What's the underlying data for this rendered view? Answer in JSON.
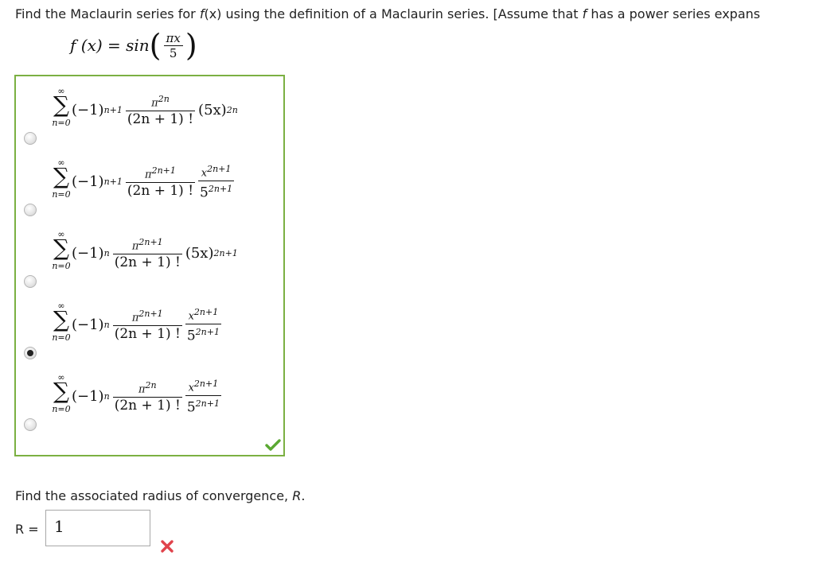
{
  "question1": {
    "text_a": "Find the Maclaurin series for ",
    "fx_italic": "f",
    "text_b": "(x) using the definition of a Maclaurin series. [Assume that ",
    "f_italic": "f",
    "text_c": " has a power series expans"
  },
  "function": {
    "lhs": "f (x) = sin",
    "numerator": "πx",
    "denominator": "5"
  },
  "options": [
    {
      "selected": false,
      "sum_top": "∞",
      "sum_bottom": "n=0",
      "sign": "(−1)",
      "sign_exp": "n+1",
      "num": "π",
      "num_exp": "2n",
      "den": "(2n + 1) !",
      "tail": "(5x)",
      "tail_exp": "2n"
    },
    {
      "selected": false,
      "sum_top": "∞",
      "sum_bottom": "n=0",
      "sign": "(−1)",
      "sign_exp": "n+1",
      "num": "π",
      "num_exp": "2n+1",
      "den": "(2n + 1) !",
      "num2": "x",
      "num2_exp": "2n+1",
      "den2": "5",
      "den2_exp": "2n+1"
    },
    {
      "selected": false,
      "sum_top": "∞",
      "sum_bottom": "n=0",
      "sign": "(−1)",
      "sign_exp": "n",
      "num": "π",
      "num_exp": "2n+1",
      "den": "(2n + 1) !",
      "tail": "(5x)",
      "tail_exp": "2n+1"
    },
    {
      "selected": true,
      "sum_top": "∞",
      "sum_bottom": "n=0",
      "sign": "(−1)",
      "sign_exp": "n",
      "num": "π",
      "num_exp": "2n+1",
      "den": "(2n + 1) !",
      "num2": "x",
      "num2_exp": "2n+1",
      "den2": "5",
      "den2_exp": "2n+1"
    },
    {
      "selected": false,
      "sum_top": "∞",
      "sum_bottom": "n=0",
      "sign": "(−1)",
      "sign_exp": "n",
      "num": "π",
      "num_exp": "2n",
      "den": "(2n + 1) !",
      "num2": "x",
      "num2_exp": "2n+1",
      "den2": "5",
      "den2_exp": "2n+1"
    }
  ],
  "question2": {
    "text_a": "Find the associated radius of convergence, ",
    "r_italic": "R",
    "text_b": "."
  },
  "radius": {
    "label": "R =",
    "value": "1"
  },
  "colors": {
    "correct_border": "#7bb042",
    "check": "#5aa832",
    "wrong": "#e0434b"
  },
  "icons": {
    "correct": "checkmark-icon",
    "incorrect": "x-mark-icon"
  }
}
